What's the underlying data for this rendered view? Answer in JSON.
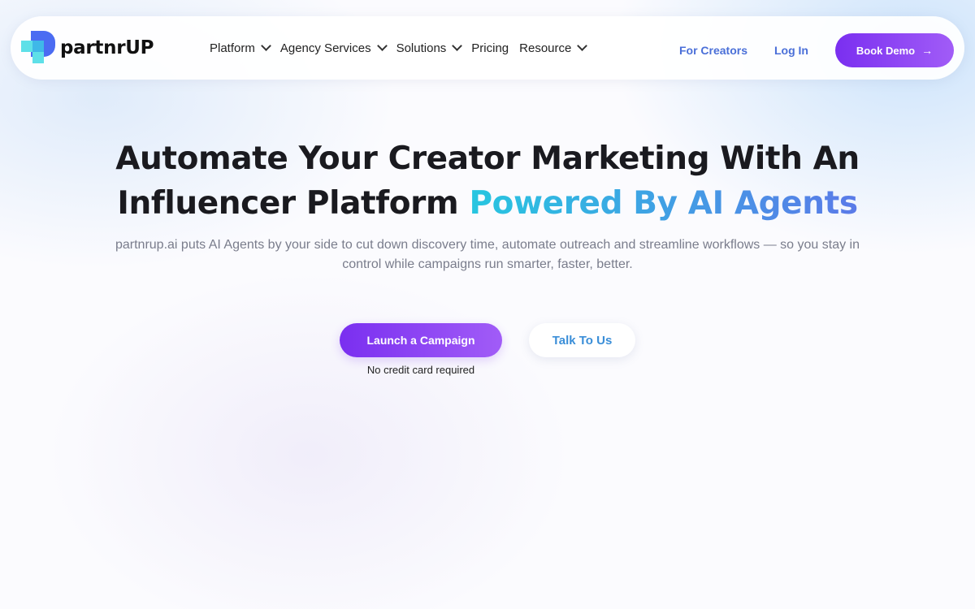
{
  "brand": {
    "name": "partnrUP"
  },
  "nav": {
    "items": [
      {
        "label": "Platform",
        "has_dropdown": true
      },
      {
        "label": "Agency Services",
        "has_dropdown": true
      },
      {
        "label": "Solutions",
        "has_dropdown": true
      },
      {
        "label": "Pricing",
        "has_dropdown": false
      },
      {
        "label": "Resource",
        "has_dropdown": true
      }
    ],
    "for_creators": "For Creators",
    "login": "Log In",
    "book_demo": "Book Demo",
    "book_demo_icon": "arrow-right-icon"
  },
  "hero": {
    "title_line1": "Automate Your Creator Marketing With An",
    "title_line2_plain": "Influencer Platform ",
    "title_line2_accent": "Powered By AI Agents",
    "subtitle": "partnrup.ai puts AI Agents by your side to cut down discovery time, automate outreach and streamline workflows — so you stay in control while campaigns run smarter, faster, better.",
    "cta_primary": "Launch a Campaign",
    "cta_secondary": "Talk To Us",
    "note": "No credit card required"
  },
  "colors": {
    "primary_gradient_start": "#7a2ff0",
    "primary_gradient_end": "#a15cf7",
    "accent_cyan": "#27c6e0",
    "accent_blue": "#5a7ae8",
    "link_blue": "#4a6fd8"
  }
}
